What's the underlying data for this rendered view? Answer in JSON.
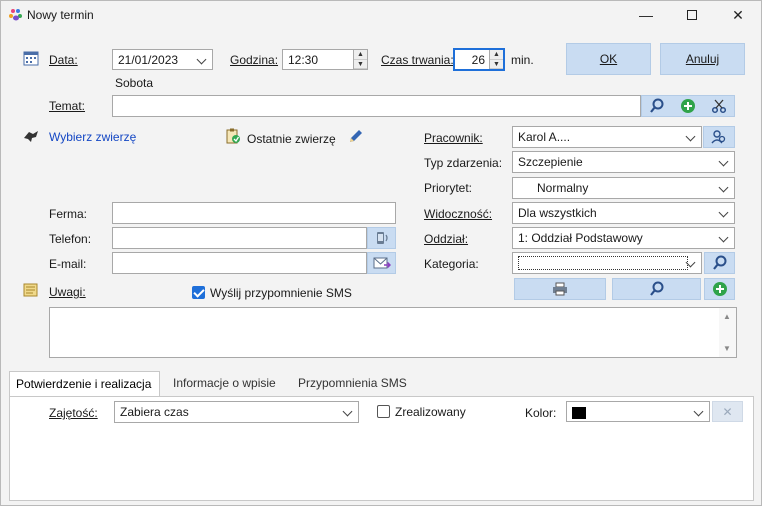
{
  "window": {
    "title": "Nowy termin"
  },
  "date": {
    "label": "Data:",
    "value": "21/01/2023",
    "weekday": "Sobota"
  },
  "time": {
    "label": "Godzina:",
    "value": "12:30"
  },
  "duration": {
    "label": "Czas trwania:",
    "value": "26",
    "unit": "min."
  },
  "buttons": {
    "ok": "OK",
    "cancel": "Anuluj"
  },
  "subject": {
    "label": "Temat:",
    "value": ""
  },
  "animal": {
    "choose": "Wybierz zwierzę",
    "recent": "Ostatnie zwierzę"
  },
  "owner": {
    "farm_label": "Ferma:",
    "farm_value": "",
    "phone_label": "Telefon:",
    "phone_value": "",
    "email_label": "E-mail:",
    "email_value": ""
  },
  "notes": {
    "label": "Uwagi:",
    "sms_label": "Wyślij przypomnienie SMS",
    "sms_checked": true,
    "value": ""
  },
  "right": {
    "employee_label": "Pracownik:",
    "employee_value": "Karol A....",
    "event_type_label": "Typ zdarzenia:",
    "event_type_value": "Szczepienie",
    "priority_label": "Priorytet:",
    "priority_value": "Normalny",
    "visibility_label": "Widoczność:",
    "visibility_value": "Dla wszystkich",
    "branch_label": "Oddział:",
    "branch_value": "1: Oddział Podstawowy",
    "category_label": "Kategoria:",
    "category_value": ""
  },
  "tabs": [
    "Potwierdzenie i realizacja",
    "Informacje o wpisie",
    "Przypomnienia SMS"
  ],
  "panel": {
    "busy_label": "Zajętość:",
    "busy_value": "Zabiera czas",
    "realized_label": "Zrealizowany",
    "realized_checked": false,
    "color_label": "Kolor:",
    "color_value": "#000000"
  }
}
